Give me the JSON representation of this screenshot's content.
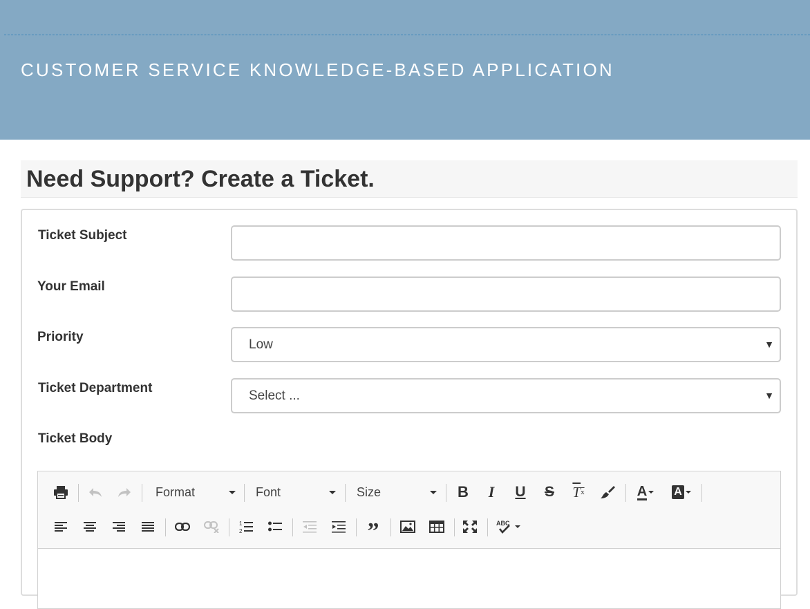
{
  "header": {
    "app_title": "CUSTOMER SERVICE KNOWLEDGE-BASED APPLICATION"
  },
  "page": {
    "heading": "Need Support? Create a Ticket."
  },
  "form": {
    "subject_label": "Ticket Subject",
    "subject_value": "",
    "email_label": "Your Email",
    "email_value": "",
    "priority_label": "Priority",
    "priority_value": "Low",
    "department_label": "Ticket Department",
    "department_value": "Select ...",
    "body_label": "Ticket Body"
  },
  "editor": {
    "format_label": "Format",
    "font_label": "Font",
    "size_label": "Size",
    "icons": [
      "print-icon",
      "undo-icon",
      "redo-icon",
      "bold-icon",
      "italic-icon",
      "underline-icon",
      "strikethrough-icon",
      "remove-format-icon",
      "copy-format-icon",
      "text-color-icon",
      "background-color-icon",
      "align-left-icon",
      "align-center-icon",
      "align-right-icon",
      "justify-icon",
      "link-icon",
      "unlink-icon",
      "numbered-list-icon",
      "bulleted-list-icon",
      "decrease-indent-icon",
      "increase-indent-icon",
      "blockquote-icon",
      "image-icon",
      "table-icon",
      "maximize-icon",
      "spellcheck-icon"
    ]
  },
  "colors": {
    "header_bg": "#84a9c4",
    "dash": "#3f86b8",
    "heading_bg": "#f6f6f6"
  }
}
